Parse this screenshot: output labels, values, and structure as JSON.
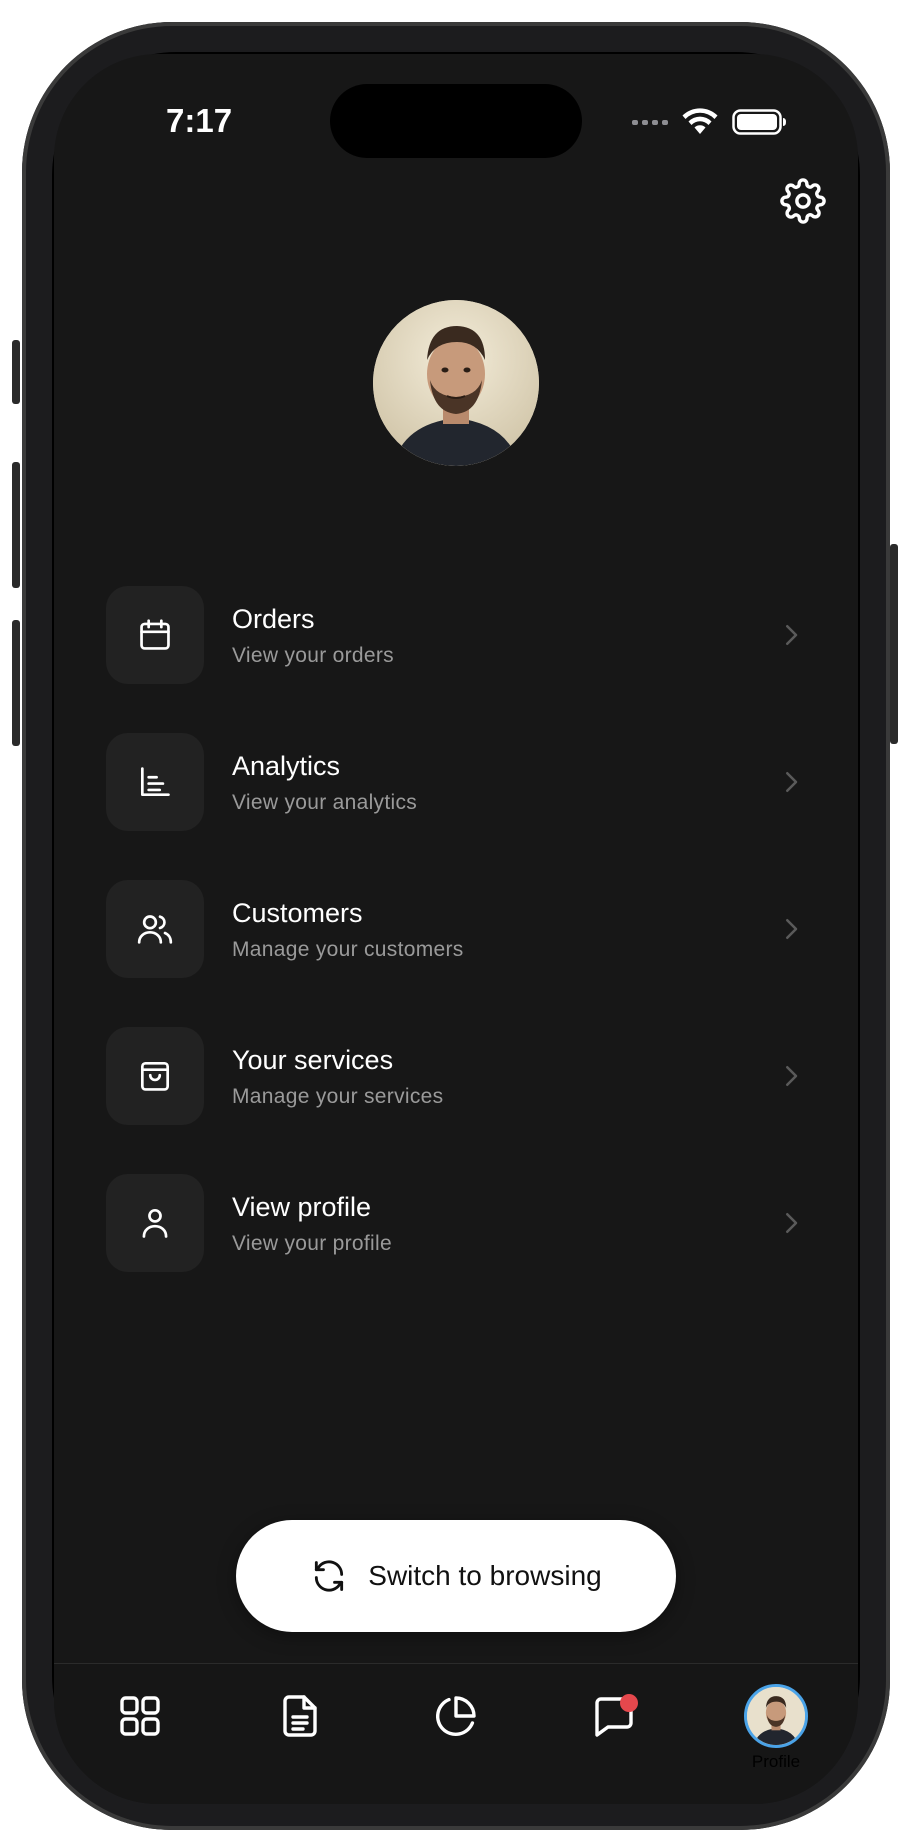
{
  "status_bar": {
    "time": "7:17"
  },
  "header": {
    "settings_icon": "gear-icon"
  },
  "profile": {
    "avatar_alt": "Profile photo"
  },
  "menu": {
    "items": [
      {
        "title": "Orders",
        "subtitle": "View your orders",
        "icon": "calendar-icon"
      },
      {
        "title": "Analytics",
        "subtitle": "View your analytics",
        "icon": "bar-chart-icon"
      },
      {
        "title": "Customers",
        "subtitle": "Manage your customers",
        "icon": "users-icon"
      },
      {
        "title": "Your services",
        "subtitle": "Manage your services",
        "icon": "shopping-bag-icon"
      },
      {
        "title": "View profile",
        "subtitle": "View your profile",
        "icon": "user-icon"
      }
    ]
  },
  "switch_button": {
    "label": "Switch to browsing",
    "icon": "refresh-icon"
  },
  "tab_bar": {
    "tabs": [
      {
        "icon": "grid-icon"
      },
      {
        "icon": "document-icon"
      },
      {
        "icon": "pie-chart-icon"
      },
      {
        "icon": "message-icon",
        "has_badge": true
      },
      {
        "icon": "avatar",
        "label": "Profile",
        "active": true
      }
    ]
  },
  "colors": {
    "background": "#171717",
    "tile": "#222222",
    "badge": "#e5484d",
    "active_ring": "#4aa3e8"
  }
}
